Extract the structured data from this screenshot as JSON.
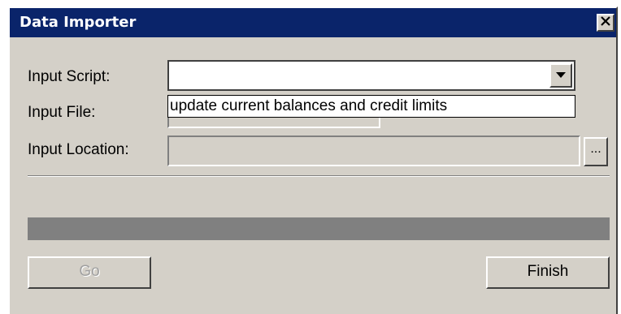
{
  "window": {
    "title": "Data Importer"
  },
  "form": {
    "script_label": "Input Script:",
    "script_value": "",
    "script_options": [
      "update current balances and credit limits"
    ],
    "file_label": "Input File:",
    "file_value": "",
    "location_label": "Input Location:",
    "location_value": "",
    "browse_label": "..."
  },
  "progress": {
    "fraction": 0
  },
  "buttons": {
    "go_label": "Go",
    "go_enabled": false,
    "finish_label": "Finish"
  },
  "icons": {
    "close": "close-icon",
    "dropdown": "chevron-down-icon"
  },
  "colors": {
    "titlebar": "#0a246a",
    "face": "#d4d0c8",
    "progress_track": "#808080"
  }
}
